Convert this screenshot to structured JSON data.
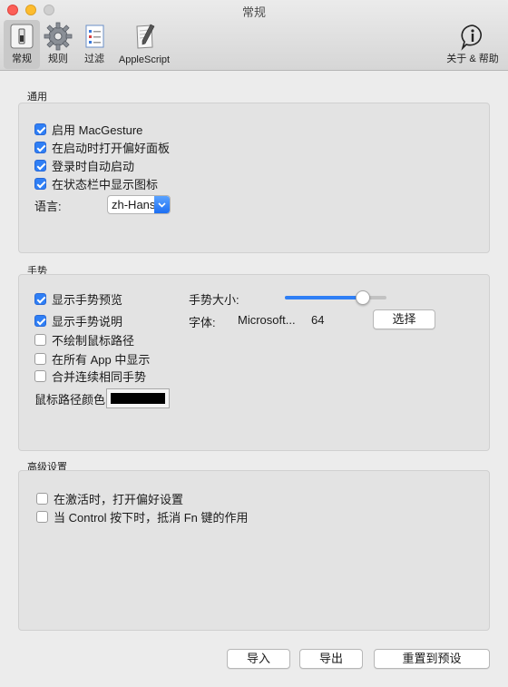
{
  "window": {
    "title": "常规"
  },
  "toolbar": {
    "items": [
      {
        "label": "常规",
        "icon": "switch-icon",
        "selected": true
      },
      {
        "label": "规则",
        "icon": "gear-icon",
        "selected": false
      },
      {
        "label": "过滤",
        "icon": "list-icon",
        "selected": false
      },
      {
        "label": "AppleScript",
        "icon": "script-icon",
        "selected": false
      }
    ],
    "about": {
      "label": "关于 & 帮助",
      "icon": "info-icon"
    }
  },
  "general": {
    "title": "通用",
    "checks": [
      {
        "label": "启用 MacGesture",
        "checked": true
      },
      {
        "label": "在启动时打开偏好面板",
        "checked": true
      },
      {
        "label": "登录时自动启动",
        "checked": true
      },
      {
        "label": "在状态栏中显示图标",
        "checked": true
      }
    ],
    "language_label": "语言:",
    "language_value": "zh-Hans"
  },
  "gesture": {
    "title": "手势",
    "checks": [
      {
        "label": "显示手势预览",
        "checked": true
      },
      {
        "label": "显示手势说明",
        "checked": true
      },
      {
        "label": "不绘制鼠标路径",
        "checked": false
      },
      {
        "label": "在所有 App 中显示",
        "checked": false
      },
      {
        "label": "合并连续相同手势",
        "checked": false
      }
    ],
    "size_label": "手势大小:",
    "size_level": 0.77,
    "font_label": "字体:",
    "font_name": "Microsoft...",
    "font_size": "64",
    "choose_button": "选择",
    "path_color_label": "鼠标路径颜色",
    "path_color": "#000000"
  },
  "advanced": {
    "title": "高级设置",
    "checks": [
      {
        "label": "在激活时，打开偏好设置",
        "checked": false
      },
      {
        "label": "当 Control 按下时，抵消 Fn 键的作用",
        "checked": false
      }
    ]
  },
  "footer": {
    "import_button": "导入",
    "export_button": "导出",
    "reset_button": "重置到预设"
  },
  "colors": {
    "accent": "#2f7ff5"
  }
}
